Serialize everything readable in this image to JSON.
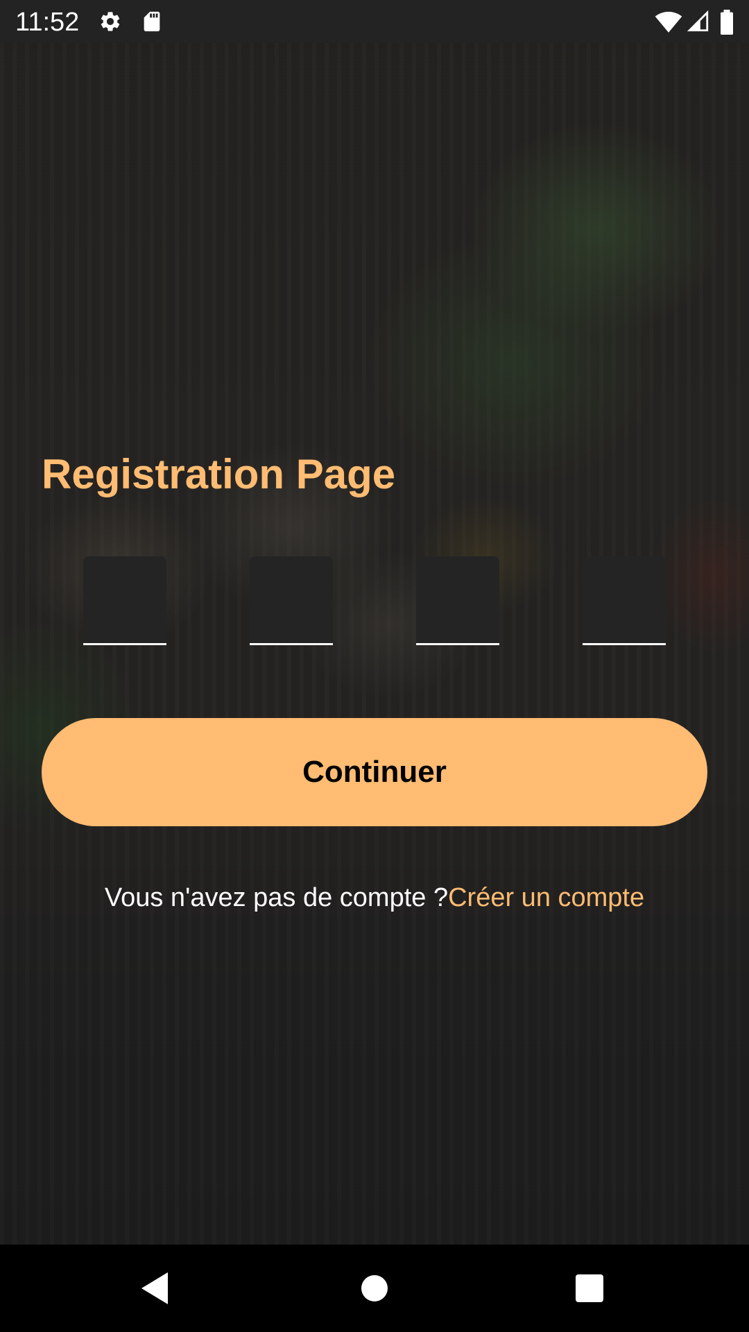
{
  "status_bar": {
    "time": "11:52",
    "icons": [
      "settings-icon",
      "sd-card-icon",
      "wifi-icon",
      "cell-signal-icon",
      "battery-icon"
    ]
  },
  "page": {
    "title": "Registration Page"
  },
  "otp": {
    "digits": [
      "",
      "",
      "",
      ""
    ],
    "box_color": "#242424",
    "underline_color": "#ffffff"
  },
  "continue_button": {
    "label": "Continuer",
    "color": "#ffbc72"
  },
  "signup": {
    "prompt": "Vous n'avez pas de compte ?",
    "link": "Créer un compte",
    "link_color": "#ffbc72"
  },
  "nav_bar": {
    "icons": [
      "back-icon",
      "home-icon",
      "recents-icon"
    ]
  }
}
